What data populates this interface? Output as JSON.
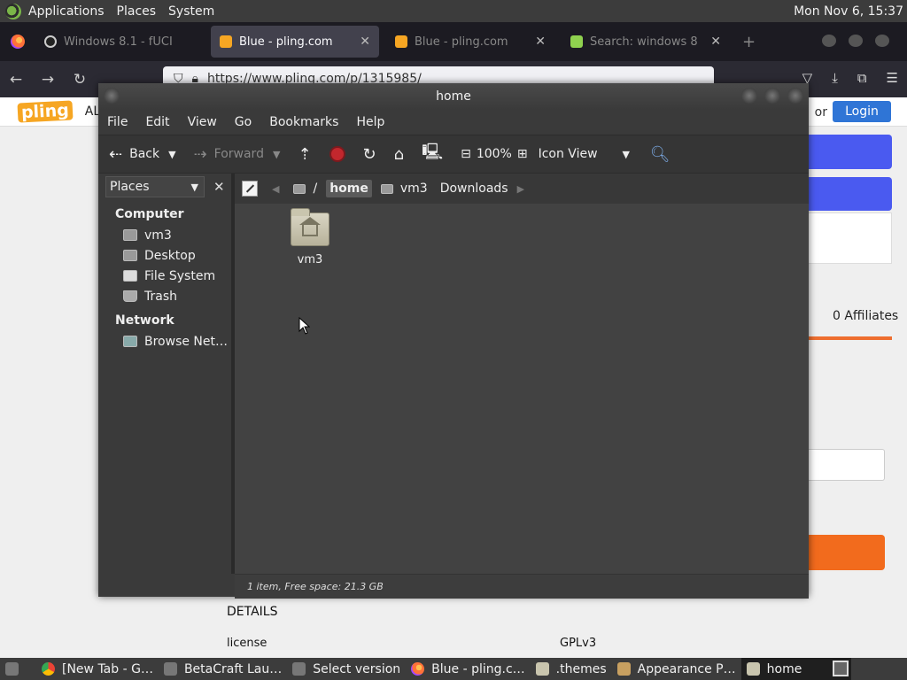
{
  "top_panel": {
    "menus": [
      "Applications",
      "Places",
      "System"
    ],
    "clock": "Mon Nov 6, 15:37"
  },
  "browser": {
    "tabs": [
      {
        "label": "Windows 8.1 - fUCI",
        "active": false
      },
      {
        "label": "Blue - pling.com",
        "active": true
      },
      {
        "label": "Blue - pling.com",
        "active": false
      },
      {
        "label": "Search: windows 8",
        "active": false
      }
    ],
    "url": "https://www.pling.com/p/1315985/",
    "page": {
      "logo": "pling",
      "all_label": "AL",
      "or_text": "or",
      "login_label": "Login",
      "affiliates": "0 Affiliates",
      "details_heading": "DETAILS",
      "license_label": "license",
      "license_value": "GPLv3"
    }
  },
  "file_manager": {
    "title": "home",
    "menu": [
      "File",
      "Edit",
      "View",
      "Go",
      "Bookmarks",
      "Help"
    ],
    "toolbar": {
      "back": "Back",
      "forward": "Forward",
      "zoom": "100%",
      "view_mode": "Icon View"
    },
    "sidebar": {
      "selector": "Places",
      "sections": [
        {
          "heading": "Computer",
          "items": [
            "vm3",
            "Desktop",
            "File System",
            "Trash"
          ]
        },
        {
          "heading": "Network",
          "items": [
            "Browse Net…"
          ]
        }
      ]
    },
    "path": {
      "root": "/",
      "crumbs": [
        "home",
        "vm3",
        "Downloads"
      ],
      "active": "home"
    },
    "files": [
      {
        "name": "vm3",
        "type": "home-folder"
      }
    ],
    "status": "1 item, Free space: 21.3 GB"
  },
  "taskbar": {
    "items": [
      {
        "label": "[New Tab - G…",
        "icon": "chrome-icon"
      },
      {
        "label": "BetaCraft Lau…",
        "icon": "app-icon"
      },
      {
        "label": "Select version",
        "icon": "app-icon"
      },
      {
        "label": "Blue - pling.c…",
        "icon": "firefox-icon"
      },
      {
        "label": ".themes",
        "icon": "folder-icon"
      },
      {
        "label": "Appearance P…",
        "icon": "appearance-icon"
      },
      {
        "label": "home",
        "icon": "folder-icon",
        "active": true
      }
    ]
  },
  "colors": {
    "panel": "#3c3c3c",
    "login": "#2f75d6",
    "accent_blue": "#4a5af0",
    "accent_orange": "#f26b1d",
    "stop": "#c2272d"
  }
}
